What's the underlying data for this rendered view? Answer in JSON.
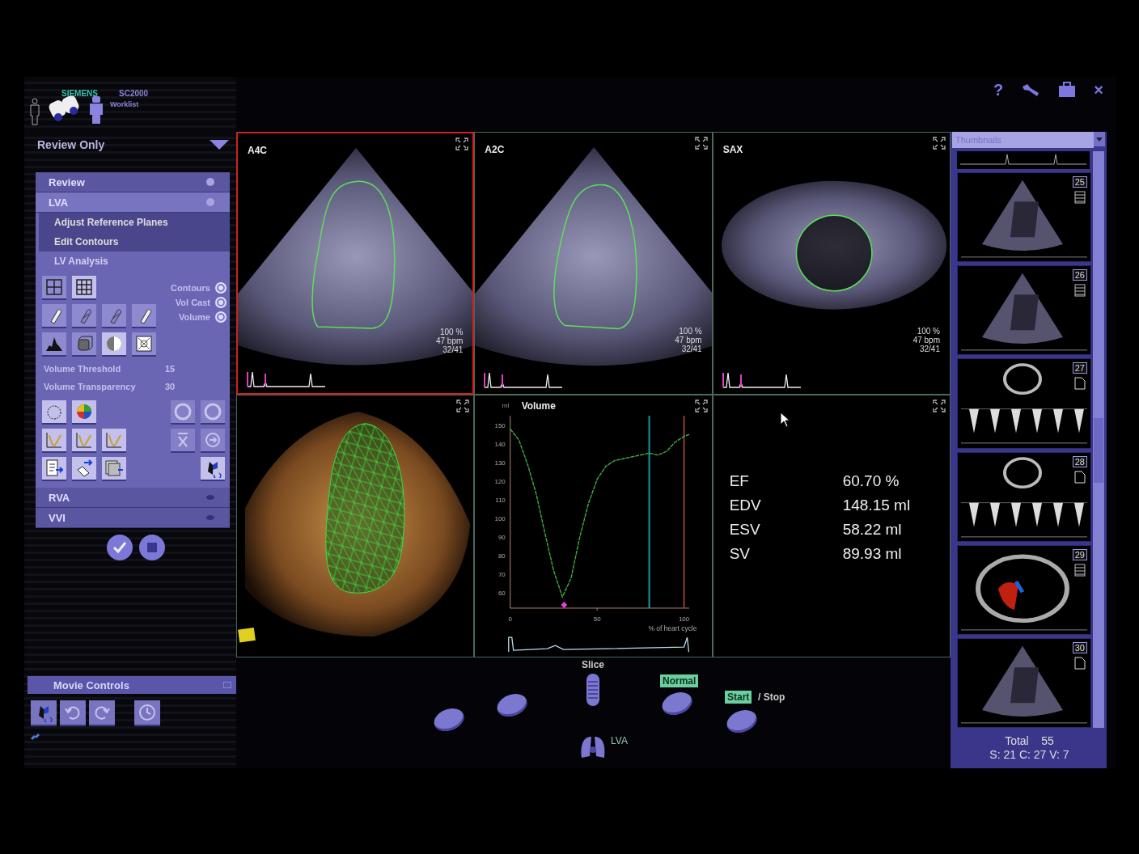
{
  "header": {
    "brand": "SIEMENS",
    "model": "SC2000",
    "worklist": "Worklist",
    "help": "?",
    "close": "×"
  },
  "mode": {
    "label": "Review Only"
  },
  "sections_top": [
    {
      "label": "Review",
      "selected": false
    },
    {
      "label": "LVA",
      "selected": true
    }
  ],
  "lva_steps": [
    {
      "label": "Adjust Reference Planes",
      "selected": false
    },
    {
      "label": "Edit Contours",
      "selected": false
    },
    {
      "label": "LV Analysis",
      "selected": true
    }
  ],
  "display_options": [
    {
      "label": "Contours"
    },
    {
      "label": "Vol Cast"
    },
    {
      "label": "Volume"
    }
  ],
  "parameters": [
    {
      "label": "Volume Threshold",
      "value": "15"
    },
    {
      "label": "Volume Transparency",
      "value": "30"
    }
  ],
  "sections_bottom": [
    {
      "label": "RVA"
    },
    {
      "label": "VVI"
    }
  ],
  "movie_controls": {
    "title": "Movie Controls"
  },
  "views": [
    {
      "kind": "a4c",
      "label": "A4C",
      "selected": true,
      "readouts": [
        "100 %",
        "47 bpm",
        "32/41"
      ]
    },
    {
      "kind": "a2c",
      "label": "A2C",
      "selected": false,
      "readouts": [
        "100 %",
        "47 bpm",
        "32/41"
      ]
    },
    {
      "kind": "sax",
      "label": "SAX",
      "selected": false,
      "readouts": [
        "100 %",
        "47 bpm",
        "32/41"
      ]
    }
  ],
  "volume_chart": {
    "chart_data": {
      "type": "line",
      "ylabel": "ml",
      "xlabel": "% of heart cycle",
      "x": [
        0,
        5,
        10,
        15,
        20,
        25,
        30,
        35,
        40,
        45,
        50,
        55,
        60,
        65,
        70,
        75,
        80,
        85,
        90,
        95,
        100,
        103
      ],
      "series": [
        {
          "name": "Volume",
          "color": "#3fae3f",
          "line_style": "dashed",
          "values": [
            148,
            142,
            129,
            113,
            92,
            72,
            58,
            68,
            90,
            108,
            121,
            128,
            131,
            132,
            133,
            134,
            135,
            134,
            136,
            141,
            144,
            145
          ]
        }
      ],
      "xlim": [
        0,
        103
      ],
      "ylim": [
        52,
        155
      ],
      "xticks": [
        0,
        50,
        100
      ],
      "yticks": [
        60,
        70,
        80,
        90,
        100,
        110,
        120,
        130,
        140,
        150
      ],
      "ref_lines": [
        {
          "axis": "x",
          "value": 80,
          "color": "#1a9a9a"
        },
        {
          "axis": "x",
          "value": 100,
          "color": "#8a4030"
        }
      ]
    }
  },
  "results": [
    {
      "name": "EF",
      "value": "60.70 %"
    },
    {
      "name": "EDV",
      "value": "148.15 ml"
    },
    {
      "name": "ESV",
      "value": "58.22 ml"
    },
    {
      "name": "SV",
      "value": "89.93 ml"
    }
  ],
  "controls": {
    "slice": "Slice",
    "speed": "Normal",
    "start": "Start",
    "stop": "/ Stop",
    "mode": "LVA"
  },
  "thumbnails": {
    "placeholder": "Thumbnails",
    "items": [
      {
        "number": "25",
        "kind": "apical",
        "multi_frame": true
      },
      {
        "number": "26",
        "kind": "apical",
        "multi_frame": true
      },
      {
        "number": "27",
        "kind": "doppler",
        "multi_frame": false
      },
      {
        "number": "28",
        "kind": "doppler",
        "multi_frame": false
      },
      {
        "number": "29",
        "kind": "color",
        "multi_frame": true
      },
      {
        "number": "30",
        "kind": "apical",
        "multi_frame": false
      }
    ],
    "total_label": "Total",
    "total": "55",
    "breakdown": "S: 21 C: 27 V: 7"
  }
}
